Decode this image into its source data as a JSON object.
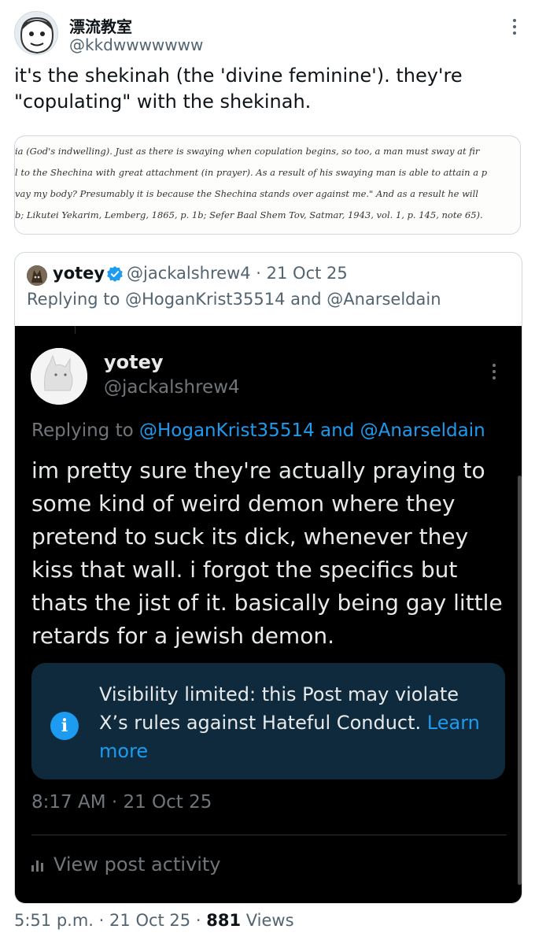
{
  "tweet": {
    "author_name": "漂流教室",
    "author_handle": "@kkdwwwwwww",
    "text": "it's the shekinah (the 'divine feminine'). they're \"copulating\" with the shekinah.",
    "timestamp": "5:51 p.m.",
    "date": "21 Oct 25",
    "views_count": "881",
    "views_label": "Views"
  },
  "book_excerpt": {
    "lines": [
      "ia (God's indwelling). Just as there is swaying when copulation begins, so too, a man must sway at fir",
      "l to the Shechina with great attachment (in prayer). As a result of his swaying man is able to attain a p",
      "vay my body? Presumably it is because the Shechina stands over against me.\" And as a result he will",
      "b; Likutei Yekarim, Lemberg, 1865, p. 1b; Sefer Baal Shem Tov, Satmar, 1943, vol. 1, p. 145, note 65)."
    ]
  },
  "quote": {
    "name": "yotey",
    "meta": "@jackalshrew4 · 21 Oct 25",
    "replying": "Replying to @HoganKrist35514 and @Anarseldain",
    "embedded": {
      "name": "yotey",
      "handle": "@jackalshrew4",
      "replying_prefix": "Replying to",
      "replying_links": "@HoganKrist35514 and @Anarseldain",
      "text": "im pretty sure they're actually praying to some kind of weird demon where they pretend to suck its dick, whenever they kiss that wall. i forgot the specifics but thats the jist of it. basically being gay little retards for a jewish demon.",
      "notice_text": "Visibility limited: this Post may violate X’s rules against Hateful Conduct.",
      "notice_link": "Learn more",
      "notice_icon": "i",
      "time": "8:17 AM · 21 Oct 25",
      "activity": "View post activity"
    }
  },
  "colors": {
    "accent": "#1d9bf0",
    "muted_light": "#536471",
    "muted_dark": "#71767b",
    "notice_bg": "#0e2a3c"
  }
}
